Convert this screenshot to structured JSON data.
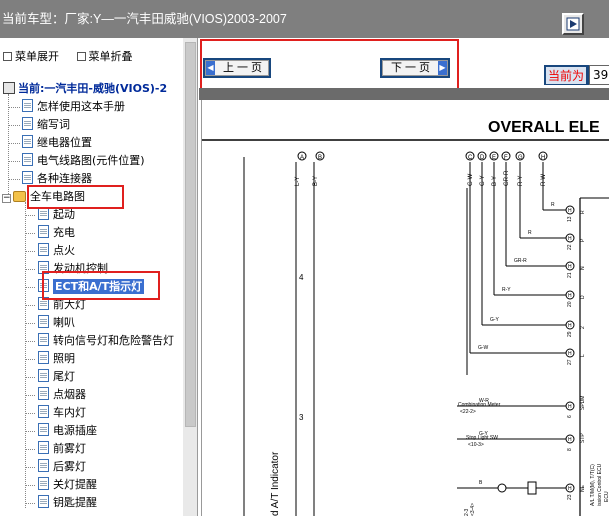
{
  "header": {
    "vehicle_label": "当前车型：",
    "vehicle_value": "厂家:Y—一汽丰田威驰(VIOS)2003-2007"
  },
  "menu": {
    "expand_label": "菜单展开",
    "collapse_label": "菜单折叠"
  },
  "tree": {
    "root_label": "当前:一汽丰田-威驰(VIOS)-2",
    "top_items": [
      "怎样使用这本手册",
      "缩写词",
      "继电器位置",
      "电气线路图(元件位置)",
      "各种连接器"
    ],
    "folder_label": "全车电路图",
    "folder_items": [
      "起动",
      "充电",
      "点火",
      "发动机控制",
      "ECT和A/T指示灯",
      "前大灯",
      "喇叭",
      "转向信号灯和危险警告灯",
      "照明",
      "尾灯",
      "点烟器",
      "车内灯",
      "电源插座",
      "前雾灯",
      "后雾灯",
      "关灯提醒",
      "钥匙提醒"
    ],
    "selected_index": 4
  },
  "navigation": {
    "prev_label": "上一页",
    "next_label": "下一页",
    "page_label": "当前为",
    "page_value": "39"
  },
  "diagram": {
    "title": "OVERALL ELE",
    "left_connectors": [
      "A",
      "B"
    ],
    "left_wires": [
      "L-Y",
      "B-Y"
    ],
    "left_numbers": [
      "4",
      "3"
    ],
    "rotated_label": "d A/T Indicator",
    "top_connectors": [
      "C",
      "D",
      "E",
      "F",
      "G",
      "H"
    ],
    "top_wires": [
      "G-W",
      "G-Y",
      "B-Y",
      "GR-R",
      "R-Y",
      "R-W"
    ],
    "rows": [
      {
        "wire": "R",
        "pin_letter": "H",
        "pin_num": "13",
        "term": "R"
      },
      {
        "wire": "R",
        "pin_letter": "H",
        "pin_num": "22",
        "term": "P"
      },
      {
        "wire": "GR-R",
        "pin_letter": "H",
        "pin_num": "21",
        "term": "N"
      },
      {
        "wire": "R-Y",
        "pin_letter": "H",
        "pin_num": "20",
        "term": "D"
      },
      {
        "wire": "G-Y",
        "pin_letter": "H",
        "pin_num": "29",
        "term": "2"
      },
      {
        "wire": "G-W",
        "pin_letter": "H",
        "pin_num": "27",
        "term": "L"
      },
      {
        "wire": "W-R",
        "pin_letter": "H",
        "pin_num": "6",
        "term": "SPDM"
      },
      {
        "wire": "G-Y",
        "pin_letter": "H",
        "pin_num": "8",
        "term": "STP"
      },
      {
        "wire": "B",
        "pin_letter": "H",
        "pin_num": "23",
        "term": "NE"
      }
    ],
    "combination_meter": "Combination Meter",
    "combination_meter_ref": "<22-2>",
    "stop_light": "Stop Light SW",
    "stop_light_ref": "<10-3>",
    "ecu_label": "ECU",
    "ecu_side": "A/L T/M(M), T/T(C)",
    "ecu_side2": "ission Control ECU",
    "bottom_refs": [
      "<3-4>",
      "2-3"
    ]
  },
  "colors": {
    "highlight": "#e0201e",
    "nav_blue": "#18477e",
    "selection": "#3a6fd0",
    "title_bar": "#7f7f7f"
  }
}
